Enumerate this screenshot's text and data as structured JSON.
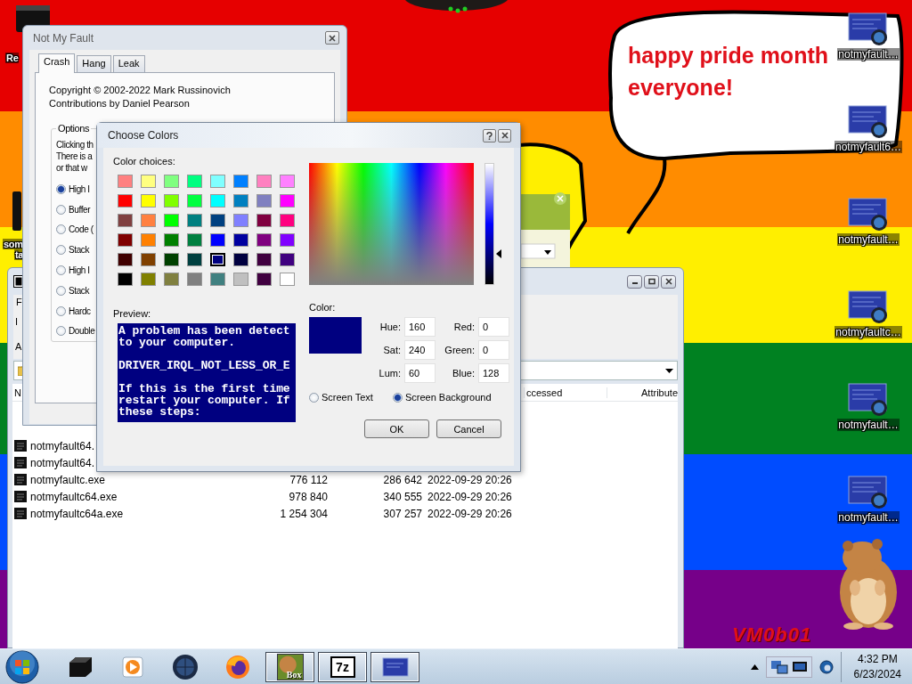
{
  "desktop": {
    "left_icons": [
      {
        "lines": [
          "Re"
        ]
      },
      {
        "lines": [
          "som",
          "ta"
        ]
      }
    ],
    "speech_bubble": {
      "text": "happy pride month everyone!"
    },
    "icons": [
      {
        "label": "notmyfault…"
      },
      {
        "label": "notmyfault6…"
      },
      {
        "label": "notmyfault…"
      },
      {
        "label": "notmyfaultc…"
      },
      {
        "label": "notmyfault…"
      },
      {
        "label": "notmyfault…"
      }
    ],
    "graffiti": "VM0b01"
  },
  "file_manager": {
    "menu": [
      "F"
    ],
    "toolbar": [
      "I",
      "A"
    ],
    "columns": [
      "N",
      "ccessed",
      "Attribute"
    ],
    "rows": [
      {
        "cells": [
          "notmyfault64."
        ]
      },
      {
        "cells": [
          "notmyfault64."
        ]
      },
      {
        "cells": [
          "notmyfaultc.exe",
          "776 112",
          "286 642",
          "2022-09-29 20:26"
        ]
      },
      {
        "cells": [
          "notmyfaultc64.exe",
          "978 840",
          "340 555",
          "2022-09-29 20:26"
        ]
      },
      {
        "cells": [
          "notmyfaultc64a.exe",
          "1 254 304",
          "307 257",
          "2022-09-29 20:26"
        ]
      }
    ]
  },
  "not_my_fault": {
    "title": "Not My Fault",
    "tabs": [
      {
        "label": "Crash",
        "selected": true
      },
      {
        "label": "Hang",
        "selected": false
      },
      {
        "label": "Leak",
        "selected": false
      }
    ],
    "copyright": "Copyright © 2002-2022 Mark Russinovich",
    "contributions": "Contributions by Daniel Pearson",
    "options": {
      "legend": "Options",
      "description": [
        "Clicking th",
        "There is a",
        "or that w"
      ],
      "radios": [
        {
          "label": "High I",
          "selected": true
        },
        {
          "label": "Buffer",
          "selected": false
        },
        {
          "label": "Code (",
          "selected": false
        },
        {
          "label": "Stack",
          "selected": false
        },
        {
          "label": "High I",
          "selected": false
        },
        {
          "label": "Stack",
          "selected": false
        },
        {
          "label": "Hardc",
          "selected": false
        },
        {
          "label": "Double",
          "selected": false
        }
      ]
    }
  },
  "choose_colors": {
    "title": "Choose Colors",
    "choices_label": "Color choices:",
    "swatches": [
      {
        "color": "#ff8080",
        "selected": false
      },
      {
        "color": "#ffff80",
        "selected": false
      },
      {
        "color": "#80ff80",
        "selected": false
      },
      {
        "color": "#00ff80",
        "selected": false
      },
      {
        "color": "#80ffff",
        "selected": false
      },
      {
        "color": "#0080ff",
        "selected": false
      },
      {
        "color": "#ff80c0",
        "selected": false
      },
      {
        "color": "#ff80ff",
        "selected": false
      },
      {
        "color": "#ff0000",
        "selected": false
      },
      {
        "color": "#ffff00",
        "selected": false
      },
      {
        "color": "#80ff00",
        "selected": false
      },
      {
        "color": "#00ff40",
        "selected": false
      },
      {
        "color": "#00ffff",
        "selected": false
      },
      {
        "color": "#0080c0",
        "selected": false
      },
      {
        "color": "#8080c0",
        "selected": false
      },
      {
        "color": "#ff00ff",
        "selected": false
      },
      {
        "color": "#804040",
        "selected": false
      },
      {
        "color": "#ff8040",
        "selected": false
      },
      {
        "color": "#00ff00",
        "selected": false
      },
      {
        "color": "#008080",
        "selected": false
      },
      {
        "color": "#004080",
        "selected": false
      },
      {
        "color": "#8080ff",
        "selected": false
      },
      {
        "color": "#800040",
        "selected": false
      },
      {
        "color": "#ff0080",
        "selected": false
      },
      {
        "color": "#800000",
        "selected": false
      },
      {
        "color": "#ff8000",
        "selected": false
      },
      {
        "color": "#008000",
        "selected": false
      },
      {
        "color": "#008040",
        "selected": false
      },
      {
        "color": "#0000ff",
        "selected": false
      },
      {
        "color": "#0000a0",
        "selected": false
      },
      {
        "color": "#800080",
        "selected": false
      },
      {
        "color": "#8000ff",
        "selected": false
      },
      {
        "color": "#400000",
        "selected": false
      },
      {
        "color": "#804000",
        "selected": false
      },
      {
        "color": "#004000",
        "selected": false
      },
      {
        "color": "#004040",
        "selected": false
      },
      {
        "color": "#000080",
        "selected": true
      },
      {
        "color": "#000040",
        "selected": false
      },
      {
        "color": "#400040",
        "selected": false
      },
      {
        "color": "#400080",
        "selected": false
      },
      {
        "color": "#000000",
        "selected": false
      },
      {
        "color": "#808000",
        "selected": false
      },
      {
        "color": "#808040",
        "selected": false
      },
      {
        "color": "#808080",
        "selected": false
      },
      {
        "color": "#408080",
        "selected": false
      },
      {
        "color": "#c0c0c0",
        "selected": false
      },
      {
        "color": "#400040",
        "selected": false
      },
      {
        "color": "#ffffff",
        "selected": false
      }
    ],
    "luminance": {
      "level": 0.25
    },
    "preview_label": "Preview:",
    "preview_text": "A problem has been detect\nto your computer.\n\nDRIVER_IRQL_NOT_LESS_OR_E\n\nIf this is the first time\nrestart your computer. If\nthese steps:",
    "color_label": "Color:",
    "color": "#000080",
    "fields": [
      {
        "label": "Hue:",
        "value": "160"
      },
      {
        "label": "Red:",
        "value": "0"
      },
      {
        "label": "Sat:",
        "value": "240"
      },
      {
        "label": "Green:",
        "value": "0"
      },
      {
        "label": "Lum:",
        "value": "60"
      },
      {
        "label": "Blue:",
        "value": "128"
      }
    ],
    "targets": [
      {
        "label": "Screen Text",
        "selected": false
      },
      {
        "label": "Screen Background",
        "selected": true
      }
    ],
    "buttons": [
      "OK",
      "Cancel"
    ]
  },
  "taskbar": {
    "items": [
      {
        "kind": "terminal",
        "active": false
      },
      {
        "kind": "media",
        "active": false
      },
      {
        "kind": "globe",
        "active": false
      },
      {
        "kind": "firefox",
        "active": false
      },
      {
        "kind": "hamster",
        "label": "Box",
        "active": true
      },
      {
        "kind": "sevenzip",
        "label": "7z",
        "active": true
      },
      {
        "kind": "screen",
        "active": true
      }
    ],
    "clock": {
      "time": "4:32 PM",
      "date": "6/23/2024"
    }
  }
}
